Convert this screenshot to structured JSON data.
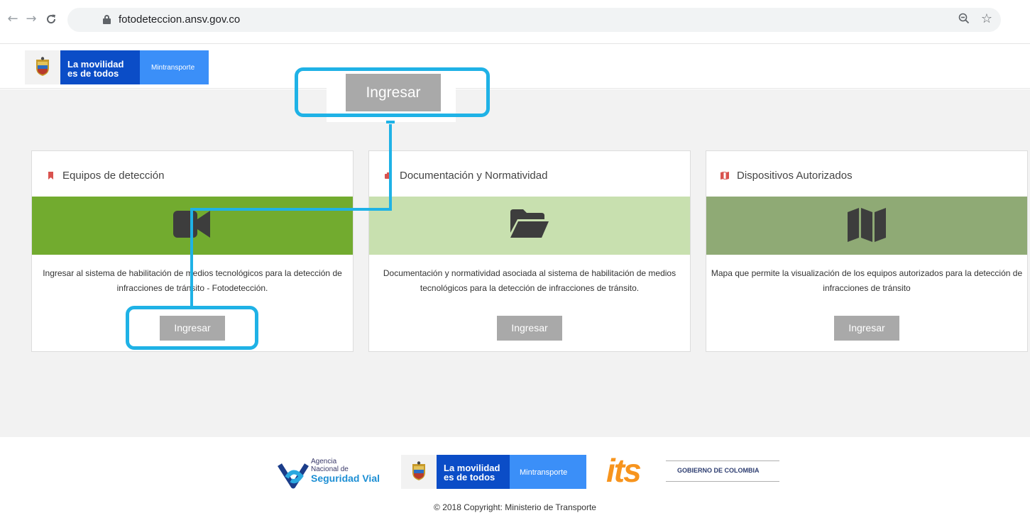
{
  "browser": {
    "url": "fotodeteccion.ansv.gov.co",
    "nav_back": "←",
    "nav_forward": "→",
    "nav_reload": "C",
    "zoom_icon": "search-minus-icon",
    "star_icon": "star-icon"
  },
  "header": {
    "logo_line1": "La movilidad",
    "logo_line2": "es de todos",
    "logo_ministry": "Mintransporte"
  },
  "callout": {
    "button_label": "Ingresar",
    "highlight_color": "#1fb2e6"
  },
  "cards": [
    {
      "title": "Equipos de detección",
      "title_icon": "bookmark-icon",
      "banner_icon": "video-camera-icon",
      "banner_color": "#72ab2f",
      "description": "Ingresar al sistema de habilitación de medios tecnológicos para la detección de infracciones de tránsito - Fotodetección.",
      "button_label": "Ingresar"
    },
    {
      "title": "Documentación y Normatividad",
      "title_icon": "briefcase-icon",
      "banner_icon": "folder-open-icon",
      "banner_color": "#c8e0af",
      "description": "Documentación y normatividad asociada al sistema de habilitación de medios tecnológicos para la detección de infracciones de tránsito.",
      "button_label": "Ingresar"
    },
    {
      "title": "Dispositivos Autorizados",
      "title_icon": "map-icon",
      "banner_icon": "map-icon",
      "banner_color": "#8faa75",
      "description": "Mapa que permite la visualización de los equipos autorizados para la detección de infracciones de tránsito",
      "button_label": "Ingresar"
    }
  ],
  "footer": {
    "ansv_line1": "Agencia",
    "ansv_line2": "Nacional de",
    "ansv_line3": "Seguridad Vial",
    "gov_line1": "La movilidad",
    "gov_line2": "es de todos",
    "gov_ministry": "Mintransporte",
    "its": "its",
    "gobierno": "GOBIERNO DE COLOMBIA",
    "copyright": "© 2018 Copyright: Ministerio de Transporte"
  }
}
